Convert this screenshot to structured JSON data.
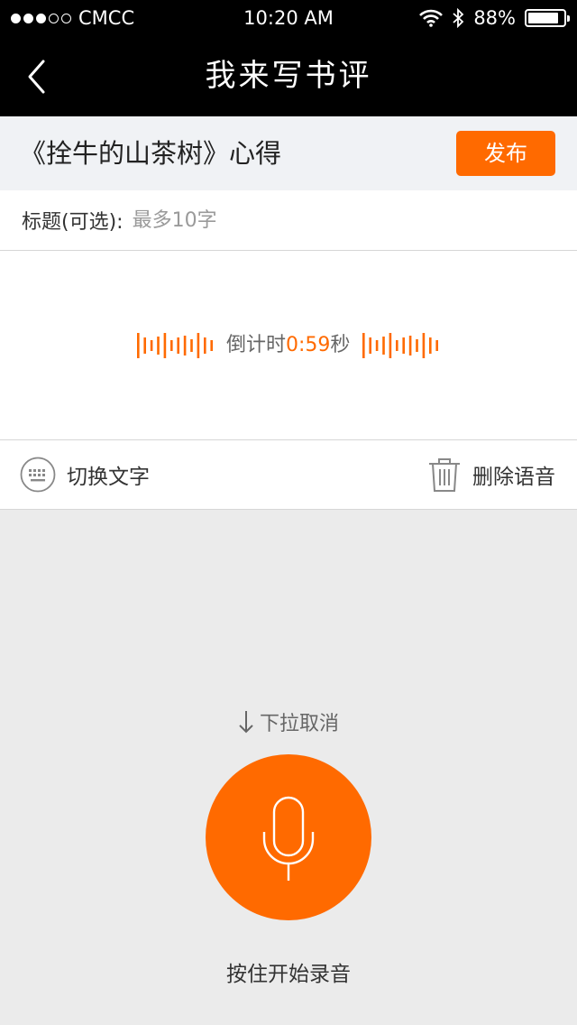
{
  "status_bar": {
    "carrier": "CMCC",
    "signal_bars": 3,
    "time": "10:20 AM",
    "battery": "88%",
    "battery_level": 0.88
  },
  "nav": {
    "title": "我来写书评",
    "back_icon": "chevron-left-icon"
  },
  "book": {
    "title": "《拴牛的山茶树》心得",
    "publish_label": "发布"
  },
  "title_field": {
    "label": "标题(可选):",
    "value": "",
    "placeholder": "最多10字"
  },
  "recording": {
    "countdown_prefix": "倒计时",
    "countdown_value": "0:59",
    "countdown_suffix": "秒"
  },
  "actions": {
    "switch_text_label": "切换文字",
    "delete_voice_label": "删除语音"
  },
  "record_panel": {
    "pull_cancel_label": "下拉取消",
    "hold_hint": "按住开始录音"
  },
  "colors": {
    "accent": "#ff6a00",
    "nav_bg": "#000000",
    "panel_bg": "#ebebeb"
  }
}
